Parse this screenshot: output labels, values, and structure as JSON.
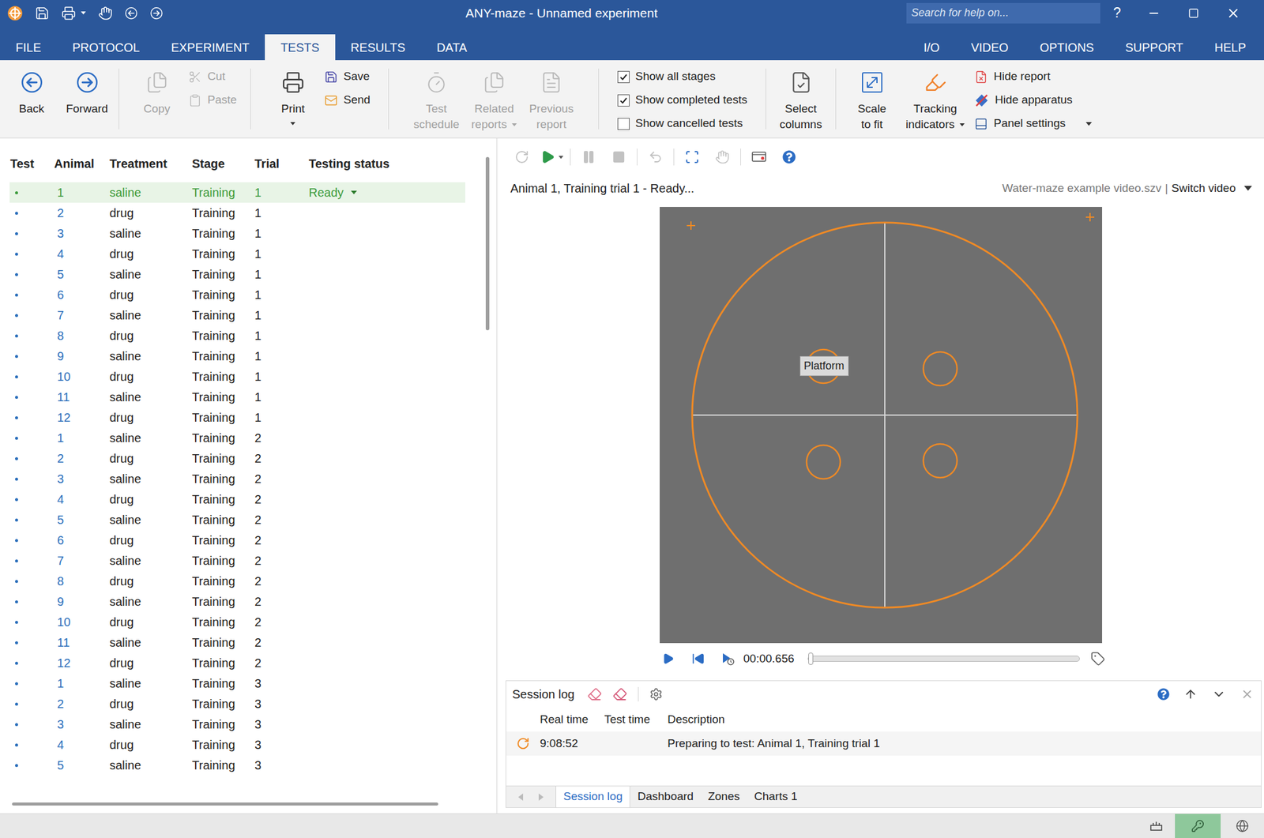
{
  "window": {
    "title": "ANY-maze - Unnamed experiment",
    "search_placeholder": "Search for help on...",
    "help": "?"
  },
  "menu": {
    "left": [
      {
        "label": "FILE",
        "selected": false
      },
      {
        "label": "PROTOCOL",
        "selected": false
      },
      {
        "label": "EXPERIMENT",
        "selected": false
      },
      {
        "label": "TESTS",
        "selected": true
      },
      {
        "label": "RESULTS",
        "selected": false
      },
      {
        "label": "DATA",
        "selected": false
      }
    ],
    "right": [
      {
        "label": "I/O",
        "selected": false
      },
      {
        "label": "VIDEO",
        "selected": false
      },
      {
        "label": "OPTIONS",
        "selected": false
      },
      {
        "label": "SUPPORT",
        "selected": false
      },
      {
        "label": "HELP",
        "selected": false
      }
    ]
  },
  "ribbon": {
    "groups": [
      {
        "items": [
          {
            "kind": "large",
            "lines": [
              "Back"
            ],
            "disabled": false,
            "dropdown": false
          },
          {
            "kind": "large",
            "lines": [
              "Forward"
            ],
            "disabled": false,
            "dropdown": false
          }
        ]
      },
      {
        "items": [
          {
            "kind": "large",
            "lines": [
              "Copy"
            ],
            "disabled": true,
            "dropdown": false
          },
          {
            "kind": "small",
            "lines": [
              "Cut"
            ],
            "disabled": true,
            "dropdown": false
          },
          {
            "kind": "small",
            "lines": [
              "Paste"
            ],
            "disabled": true,
            "dropdown": false
          }
        ]
      },
      {
        "items": [
          {
            "kind": "large",
            "lines": [
              "Print"
            ],
            "disabled": false,
            "dropdown": true
          },
          {
            "kind": "small",
            "lines": [
              "Save"
            ],
            "disabled": false,
            "dropdown": false
          },
          {
            "kind": "small",
            "lines": [
              "Send"
            ],
            "disabled": false,
            "dropdown": false
          }
        ]
      },
      {
        "items": [
          {
            "kind": "large",
            "lines": [
              "Test",
              "schedule"
            ],
            "disabled": true,
            "dropdown": false
          },
          {
            "kind": "large",
            "lines": [
              "Related",
              "reports"
            ],
            "disabled": true,
            "dropdown": true
          },
          {
            "kind": "large",
            "lines": [
              "Previous",
              "report"
            ],
            "disabled": true,
            "dropdown": false
          }
        ]
      },
      {
        "items": [
          {
            "kind": "checkbox",
            "lines": [
              "Show all stages"
            ],
            "checked": true,
            "disabled": false,
            "dropdown": false
          },
          {
            "kind": "checkbox",
            "lines": [
              "Show completed tests"
            ],
            "checked": true,
            "disabled": false,
            "dropdown": false
          },
          {
            "kind": "checkbox",
            "lines": [
              "Show cancelled tests"
            ],
            "checked": false,
            "disabled": false,
            "dropdown": false
          }
        ]
      },
      {
        "items": [
          {
            "kind": "large",
            "lines": [
              "Select",
              "columns"
            ],
            "disabled": false,
            "dropdown": false
          }
        ]
      },
      {
        "items": [
          {
            "kind": "large",
            "lines": [
              "Scale",
              "to fit"
            ],
            "disabled": false,
            "dropdown": false
          },
          {
            "kind": "large",
            "lines": [
              "Tracking",
              "indicators"
            ],
            "disabled": false,
            "dropdown": true
          },
          {
            "kind": "small",
            "lines": [
              "Hide report"
            ],
            "disabled": false,
            "dropdown": false
          },
          {
            "kind": "small",
            "lines": [
              "Hide apparatus"
            ],
            "disabled": false,
            "dropdown": false
          },
          {
            "kind": "small",
            "lines": [
              "Panel settings"
            ],
            "disabled": false,
            "dropdown": true
          }
        ]
      }
    ]
  },
  "table": {
    "columns": [
      "Test",
      "Animal",
      "Treatment",
      "Stage",
      "Trial",
      "Testing status"
    ],
    "rows": [
      {
        "animal": "1",
        "treatment": "saline",
        "stage": "Training",
        "trial": "1",
        "status": "Ready",
        "selected": true
      },
      {
        "animal": "2",
        "treatment": "drug",
        "stage": "Training",
        "trial": "1",
        "status": "",
        "selected": false
      },
      {
        "animal": "3",
        "treatment": "saline",
        "stage": "Training",
        "trial": "1",
        "status": "",
        "selected": false
      },
      {
        "animal": "4",
        "treatment": "drug",
        "stage": "Training",
        "trial": "1",
        "status": "",
        "selected": false
      },
      {
        "animal": "5",
        "treatment": "saline",
        "stage": "Training",
        "trial": "1",
        "status": "",
        "selected": false
      },
      {
        "animal": "6",
        "treatment": "drug",
        "stage": "Training",
        "trial": "1",
        "status": "",
        "selected": false
      },
      {
        "animal": "7",
        "treatment": "saline",
        "stage": "Training",
        "trial": "1",
        "status": "",
        "selected": false
      },
      {
        "animal": "8",
        "treatment": "drug",
        "stage": "Training",
        "trial": "1",
        "status": "",
        "selected": false
      },
      {
        "animal": "9",
        "treatment": "saline",
        "stage": "Training",
        "trial": "1",
        "status": "",
        "selected": false
      },
      {
        "animal": "10",
        "treatment": "drug",
        "stage": "Training",
        "trial": "1",
        "status": "",
        "selected": false
      },
      {
        "animal": "11",
        "treatment": "saline",
        "stage": "Training",
        "trial": "1",
        "status": "",
        "selected": false
      },
      {
        "animal": "12",
        "treatment": "drug",
        "stage": "Training",
        "trial": "1",
        "status": "",
        "selected": false
      },
      {
        "animal": "1",
        "treatment": "saline",
        "stage": "Training",
        "trial": "2",
        "status": "",
        "selected": false
      },
      {
        "animal": "2",
        "treatment": "drug",
        "stage": "Training",
        "trial": "2",
        "status": "",
        "selected": false
      },
      {
        "animal": "3",
        "treatment": "saline",
        "stage": "Training",
        "trial": "2",
        "status": "",
        "selected": false
      },
      {
        "animal": "4",
        "treatment": "drug",
        "stage": "Training",
        "trial": "2",
        "status": "",
        "selected": false
      },
      {
        "animal": "5",
        "treatment": "saline",
        "stage": "Training",
        "trial": "2",
        "status": "",
        "selected": false
      },
      {
        "animal": "6",
        "treatment": "drug",
        "stage": "Training",
        "trial": "2",
        "status": "",
        "selected": false
      },
      {
        "animal": "7",
        "treatment": "saline",
        "stage": "Training",
        "trial": "2",
        "status": "",
        "selected": false
      },
      {
        "animal": "8",
        "treatment": "drug",
        "stage": "Training",
        "trial": "2",
        "status": "",
        "selected": false
      },
      {
        "animal": "9",
        "treatment": "saline",
        "stage": "Training",
        "trial": "2",
        "status": "",
        "selected": false
      },
      {
        "animal": "10",
        "treatment": "drug",
        "stage": "Training",
        "trial": "2",
        "status": "",
        "selected": false
      },
      {
        "animal": "11",
        "treatment": "saline",
        "stage": "Training",
        "trial": "2",
        "status": "",
        "selected": false
      },
      {
        "animal": "12",
        "treatment": "drug",
        "stage": "Training",
        "trial": "2",
        "status": "",
        "selected": false
      },
      {
        "animal": "1",
        "treatment": "saline",
        "stage": "Training",
        "trial": "3",
        "status": "",
        "selected": false
      },
      {
        "animal": "2",
        "treatment": "drug",
        "stage": "Training",
        "trial": "3",
        "status": "",
        "selected": false
      },
      {
        "animal": "3",
        "treatment": "saline",
        "stage": "Training",
        "trial": "3",
        "status": "",
        "selected": false
      },
      {
        "animal": "4",
        "treatment": "drug",
        "stage": "Training",
        "trial": "3",
        "status": "",
        "selected": false
      },
      {
        "animal": "5",
        "treatment": "saline",
        "stage": "Training",
        "trial": "3",
        "status": "",
        "selected": false
      }
    ]
  },
  "toolbar": [
    {
      "disabled": true,
      "dropdown": false
    },
    {
      "disabled": false,
      "dropdown": true
    },
    {
      "disabled": true,
      "dropdown": false
    },
    {
      "disabled": true,
      "dropdown": false
    },
    {
      "disabled": true,
      "dropdown": false
    },
    {
      "disabled": false,
      "dropdown": false
    },
    {
      "disabled": true,
      "dropdown": false
    },
    {
      "disabled": false,
      "dropdown": false
    },
    {
      "disabled": false,
      "dropdown": false
    }
  ],
  "video": {
    "caption": "Animal 1, Training trial 1 - Ready...",
    "file": "Water-maze example video.szv",
    "separator": "|",
    "switch": "Switch video",
    "zones": [
      {
        "label": "Platform"
      },
      {
        "label": ""
      },
      {
        "label": ""
      },
      {
        "label": ""
      }
    ],
    "time": "00:00.656",
    "level": 0
  },
  "session_log": {
    "title": "Session log",
    "columns": [
      "Real time",
      "Test time",
      "Description"
    ],
    "rows": [
      {
        "real_time": "9:08:52",
        "test_time": "",
        "description": "Preparing to test: Animal 1, Training trial 1"
      }
    ]
  },
  "bottom_tabs": [
    {
      "label": "Session log",
      "selected": true
    },
    {
      "label": "Dashboard",
      "selected": false
    },
    {
      "label": "Zones",
      "selected": false
    },
    {
      "label": "Charts 1",
      "selected": false
    }
  ]
}
